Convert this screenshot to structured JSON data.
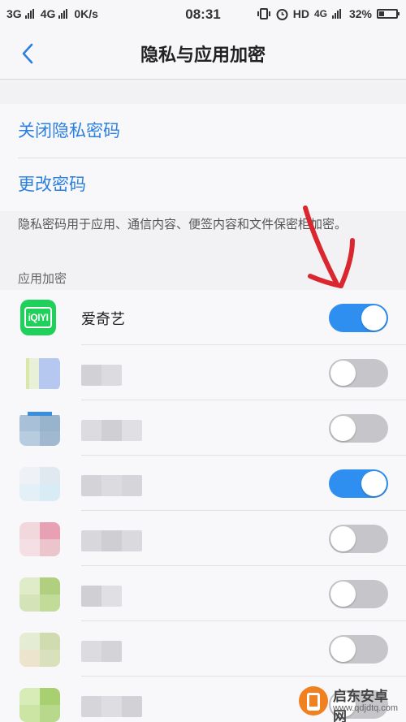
{
  "status_bar": {
    "sim1": "3G",
    "sim2": "4G",
    "speed": "0K/s",
    "time": "08:31",
    "hd": "HD",
    "network": "4G",
    "battery": "32%"
  },
  "nav": {
    "title": "隐私与应用加密"
  },
  "password": {
    "close_label": "关闭隐私密码",
    "change_label": "更改密码",
    "description": "隐私密码用于应用、通信内容、便签内容和文件保密柜加密。"
  },
  "apps": {
    "section_label": "应用加密",
    "items": [
      {
        "name": "爱奇艺",
        "enabled": true
      },
      {
        "name": "",
        "enabled": false
      },
      {
        "name": "",
        "enabled": false
      },
      {
        "name": "",
        "enabled": true
      },
      {
        "name": "",
        "enabled": false
      },
      {
        "name": "",
        "enabled": false
      },
      {
        "name": "",
        "enabled": false
      },
      {
        "name": "",
        "enabled": false
      }
    ]
  },
  "colors": {
    "accent": "#2e8ff0",
    "link": "#2b7fe0",
    "toggle_off": "#c6c6ca",
    "annotation": "#d9262f",
    "iqiyi": "#1fd05a"
  },
  "watermark": {
    "name": "启东安卓网",
    "url": "www.qdjdtq.com"
  }
}
